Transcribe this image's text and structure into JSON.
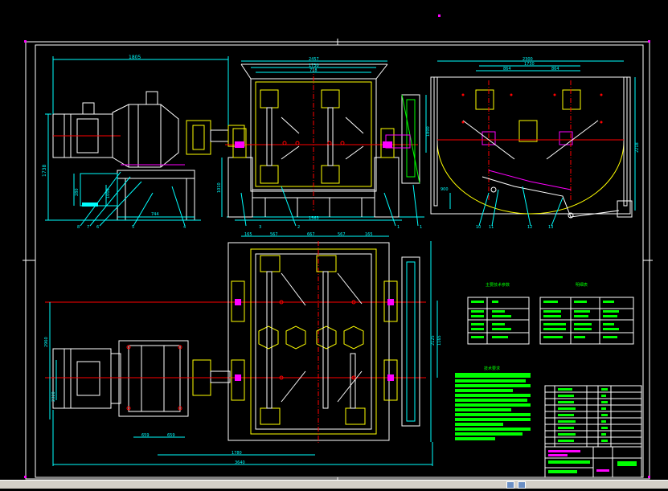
{
  "colors": {
    "background": "#000000",
    "white": "#ffffff",
    "cyan": "#00ffff",
    "yellow": "#ffff00",
    "magenta": "#ff00ff",
    "red": "#ff0000",
    "green": "#00ff00"
  },
  "dimensions": {
    "left_width": "1805",
    "front_overall": "2457",
    "front_inner": "1730",
    "front_pitch": "718",
    "side_overall": "2300",
    "side_pitch_a": "864",
    "side_pitch_b": "864",
    "side_inner": "1730",
    "left_height": "1738",
    "left_sub_height": "280",
    "left_base": "1000",
    "front_height": "1800",
    "front_sub": "1010",
    "side_height": "2218",
    "side_mid": "900",
    "base_span_left": "744",
    "base_span_front": "1563",
    "plan_a": "165",
    "plan_b": "567",
    "plan_c": "667",
    "plan_d": "567",
    "plan_e": "165",
    "plan_height": "2125",
    "plan_left_h": "2960",
    "plan_motor_h": "2320",
    "plan_right_h": "1165",
    "plan_dim_a": "659",
    "plan_dim_b": "659",
    "plan_bottom_a": "1780",
    "plan_bottom_b": "3640"
  },
  "callouts": {
    "bottom_left": [
      "8",
      "7",
      "6",
      "5",
      "4"
    ],
    "front_bottom": [
      "3",
      "2",
      "1"
    ],
    "front_mid": "1",
    "side_bottom": [
      "10",
      "11",
      "12",
      "13"
    ]
  },
  "tables": {
    "params_title": "主要技术参数",
    "parts_title": "明细表",
    "notes_title": "技术要求"
  }
}
